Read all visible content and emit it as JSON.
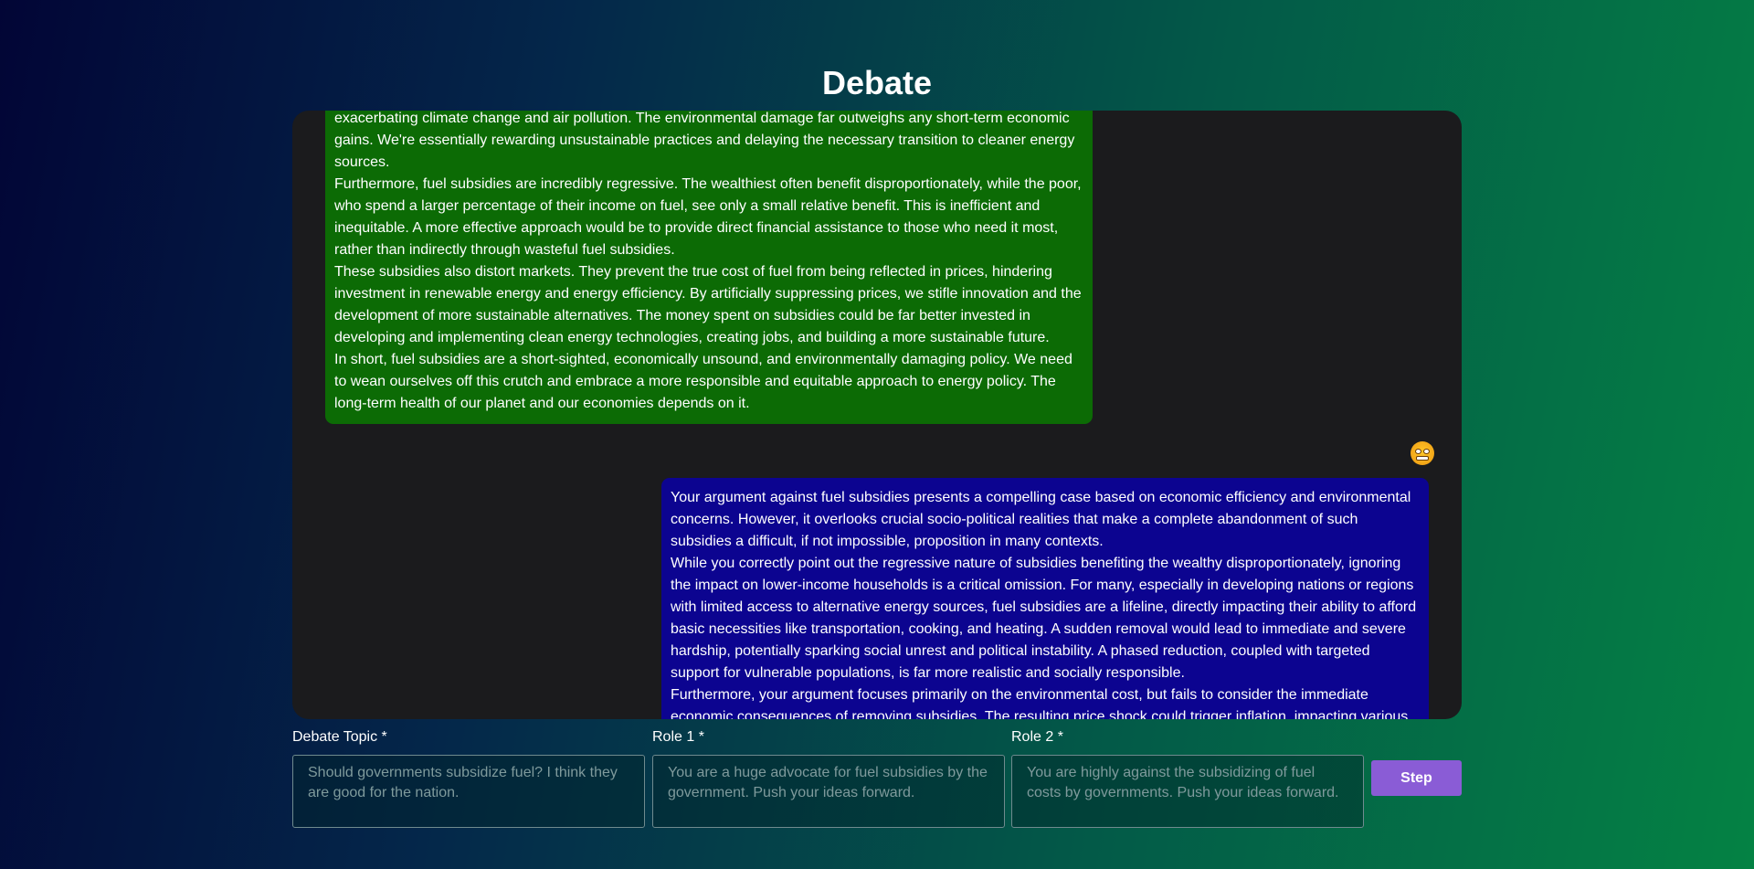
{
  "header": {
    "title": "Debate"
  },
  "chat": {
    "messages": [
      {
        "role": "role1",
        "paragraphs": [
          "exacerbating climate change and air pollution. The environmental damage far outweighs any short-term economic gains. We're essentially rewarding unsustainable practices and delaying the necessary transition to cleaner energy sources.",
          "Furthermore, fuel subsidies are incredibly regressive. The wealthiest often benefit disproportionately, while the poor, who spend a larger percentage of their income on fuel, see only a small relative benefit. This is inefficient and inequitable. A more effective approach would be to provide direct financial assistance to those who need it most, rather than indirectly through wasteful fuel subsidies.",
          "These subsidies also distort markets. They prevent the true cost of fuel from being reflected in prices, hindering investment in renewable energy and energy efficiency. By artificially suppressing prices, we stifle innovation and the development of more sustainable alternatives. The money spent on subsidies could be far better invested in developing and implementing clean energy technologies, creating jobs, and building a more sustainable future.",
          "In short, fuel subsidies are a short-sighted, economically unsound, and environmentally damaging policy. We need to wean ourselves off this crutch and embrace a more responsible and equitable approach to energy policy. The long-term health of our planet and our economies depends on it."
        ]
      },
      {
        "role": "role2",
        "avatar_icon": "grinning-face-emoji-icon",
        "paragraphs": [
          "Your argument against fuel subsidies presents a compelling case based on economic efficiency and environmental concerns. However, it overlooks crucial socio-political realities that make a complete abandonment of such subsidies a difficult, if not impossible, proposition in many contexts.",
          "While you correctly point out the regressive nature of subsidies benefiting the wealthy disproportionately, ignoring the impact on lower-income households is a critical omission. For many, especially in developing nations or regions with limited access to alternative energy sources, fuel subsidies are a lifeline, directly impacting their ability to afford basic necessities like transportation, cooking, and heating. A sudden removal would lead to immediate and severe hardship, potentially sparking social unrest and political instability. A phased reduction, coupled with targeted support for vulnerable populations, is far more realistic and socially responsible.",
          "Furthermore, your argument focuses primarily on the environmental cost, but fails to consider the immediate economic consequences of removing subsidies. The resulting price shock could trigger inflation, impacting various"
        ]
      }
    ]
  },
  "form": {
    "topic": {
      "label": "Debate Topic *",
      "placeholder": "Should governments subsidize fuel? I think they are good for the nation.",
      "value": ""
    },
    "role1": {
      "label": "Role 1 *",
      "placeholder": "You are a huge advocate for fuel subsidies by the government. Push your ideas forward.",
      "value": ""
    },
    "role2": {
      "label": "Role 2 *",
      "placeholder": "You are highly against the subsidizing of fuel costs by governments. Push your ideas forward.",
      "value": ""
    },
    "step_label": "Step"
  },
  "colors": {
    "role1_bubble": "#0c6b05",
    "role2_bubble": "#0c0490",
    "panel_background": "#1b1b1d",
    "step_button": "#8a5cd6"
  }
}
